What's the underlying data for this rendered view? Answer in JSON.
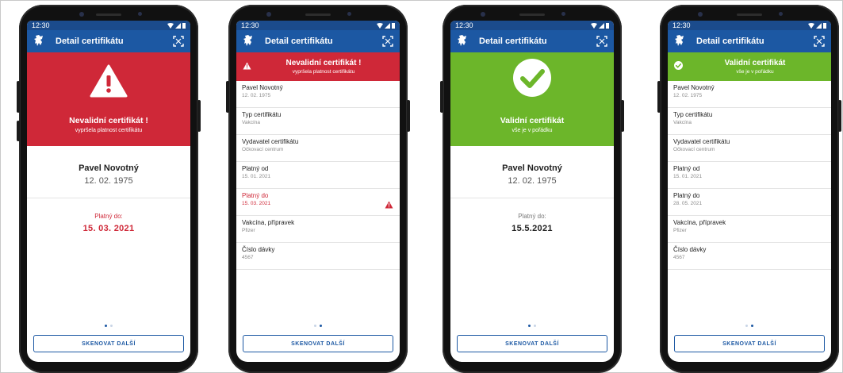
{
  "status_time": "12:30",
  "app": {
    "title": "Detail certifikátu",
    "logo": "lion-emblem-icon",
    "scan_icon": "qr-scan-icon"
  },
  "colors": {
    "blue": "#1c58a3",
    "red": "#cf2838",
    "green": "#6cb62a"
  },
  "phones": [
    {
      "hero": {
        "status": "invalid",
        "title": "Nevalidní certifikát !",
        "subtitle": "vypršela platnost certifikátu"
      },
      "holder": {
        "name": "Pavel Novotný",
        "dob": "12. 02. 1975"
      },
      "validity": {
        "label": "Platný do:",
        "value": "15. 03. 2021"
      },
      "page_indicator": {
        "current": 1,
        "total": 2
      },
      "button": "SKENOVAT DALŠÍ"
    },
    {
      "banner": {
        "status": "invalid",
        "title": "Nevalidní certifikát !",
        "subtitle": "vypršela platnost certifikátu"
      },
      "rows": [
        {
          "label": "Pavel Novotný",
          "value": "12. 02. 1975"
        },
        {
          "label": "Typ certifikátu",
          "value": "Vakcína"
        },
        {
          "label": "Vydavatel certifikátu",
          "value": "Očkovací centrum"
        },
        {
          "label": "Platný od",
          "value": "15. 01. 2021"
        },
        {
          "label": "Platný do",
          "value": "15. 03. 2021",
          "warning": true
        },
        {
          "label": "Vakcína, přípravek",
          "value": "Pfizer"
        },
        {
          "label": "Číslo dávky",
          "value": "4567"
        }
      ],
      "page_indicator": {
        "current": 2,
        "total": 2
      },
      "button": "SKENOVAT DALŠÍ"
    },
    {
      "hero": {
        "status": "valid",
        "title": "Validní certifikát",
        "subtitle": "vše je v pořádku"
      },
      "holder": {
        "name": "Pavel Novotný",
        "dob": "12. 02. 1975"
      },
      "validity": {
        "label": "Platný do:",
        "value": "15.5.2021"
      },
      "page_indicator": {
        "current": 1,
        "total": 2
      },
      "button": "SKENOVAT DALŠÍ"
    },
    {
      "banner": {
        "status": "valid",
        "title": "Validní certifikát",
        "subtitle": "vše je v pořádku"
      },
      "rows": [
        {
          "label": "Pavel Novotný",
          "value": "12. 02. 1975"
        },
        {
          "label": "Typ certifikátu",
          "value": "Vakcína"
        },
        {
          "label": "Vydavatel certifikátu",
          "value": "Očkovací centrum"
        },
        {
          "label": "Platný od",
          "value": "15. 01. 2021"
        },
        {
          "label": "Platný do",
          "value": "28. 05. 2021"
        },
        {
          "label": "Vakcína, přípravek",
          "value": "Pfizer"
        },
        {
          "label": "Číslo dávky",
          "value": "4567"
        }
      ],
      "page_indicator": {
        "current": 2,
        "total": 2
      },
      "button": "SKENOVAT DALŠÍ"
    }
  ]
}
